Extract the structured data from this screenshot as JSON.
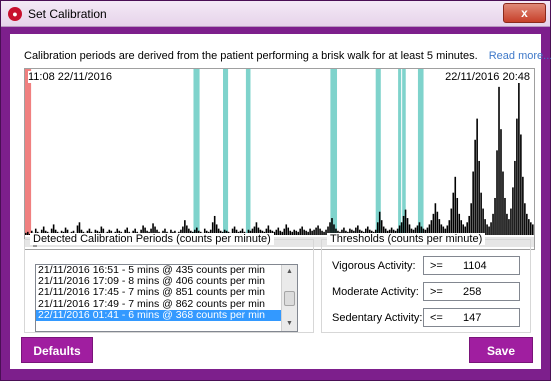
{
  "window": {
    "title": "Set Calibration",
    "close_glyph": "x",
    "app_icon": "app-logo-icon"
  },
  "info": {
    "text": "Calibration periods are derived from the patient performing a brisk walk for at least 5 minutes.",
    "link": "Read more..."
  },
  "chart": {
    "start_label": "11:08 22/11/2016",
    "end_label": "22/11/2016 20:48"
  },
  "chart_data": {
    "type": "bar",
    "title": "",
    "xlabel": "",
    "ylabel": "",
    "x_range": [
      "11:08 22/11/2016",
      "22/11/2016 20:48"
    ],
    "series": [
      {
        "values": [
          2,
          3,
          1,
          4,
          2,
          6,
          3,
          2,
          5,
          8,
          4,
          3,
          2,
          6,
          10,
          5,
          3,
          2,
          4,
          3,
          7,
          5,
          2,
          3,
          4,
          2,
          9,
          12,
          5,
          3,
          2,
          4,
          6,
          3,
          2,
          5,
          4,
          3,
          8,
          6,
          2,
          3,
          5,
          4,
          2,
          3,
          6,
          4,
          3,
          2,
          5,
          7,
          3,
          2,
          4,
          6,
          3,
          2,
          5,
          9,
          7,
          4,
          3,
          6,
          11,
          8,
          5,
          3,
          2,
          4,
          6,
          3,
          2,
          5,
          3,
          4,
          2,
          3,
          5,
          8,
          14,
          9,
          6,
          4,
          3,
          5,
          7,
          4,
          3,
          2,
          6,
          4,
          3,
          5,
          12,
          18,
          10,
          6,
          4,
          3,
          5,
          4,
          3,
          2,
          6,
          8,
          5,
          3,
          4,
          6,
          3,
          2,
          5,
          4,
          6,
          8,
          12,
          7,
          5,
          4,
          3,
          6,
          9,
          5,
          4,
          3,
          5,
          7,
          4,
          3,
          6,
          10,
          7,
          4,
          3,
          5,
          4,
          3,
          6,
          8,
          5,
          4,
          3,
          6,
          4,
          5,
          7,
          9,
          6,
          4,
          3,
          5,
          8,
          12,
          16,
          10,
          6,
          4,
          3,
          5,
          7,
          4,
          3,
          6,
          5,
          4,
          7,
          9,
          5,
          4,
          3,
          6,
          8,
          5,
          4,
          3,
          5,
          12,
          22,
          14,
          8,
          6,
          4,
          5,
          7,
          5,
          4,
          6,
          9,
          12,
          18,
          24,
          16,
          10,
          6,
          5,
          7,
          9,
          12,
          8,
          6,
          5,
          7,
          10,
          14,
          20,
          30,
          22,
          15,
          10,
          8,
          6,
          9,
          14,
          25,
          40,
          55,
          35,
          20,
          14,
          10,
          8,
          12,
          18,
          30,
          60,
          90,
          110,
          70,
          40,
          25,
          15,
          10,
          8,
          12,
          20,
          35,
          80,
          140,
          100,
          60,
          35,
          20,
          15,
          25,
          45,
          70,
          110,
          150,
          95,
          55,
          30,
          20,
          15,
          12,
          10
        ],
        "color": "#000000"
      }
    ],
    "ylim": [
      0,
      155
    ],
    "highlights": [
      {
        "kind": "flagged",
        "color": "#f08080",
        "start": 0.0,
        "end": 0.012
      },
      {
        "kind": "calibration",
        "color": "#7fd3cc",
        "start": 0.331,
        "end": 0.343
      },
      {
        "kind": "calibration",
        "color": "#7fd3cc",
        "start": 0.389,
        "end": 0.399
      },
      {
        "kind": "calibration",
        "color": "#7fd3cc",
        "start": 0.434,
        "end": 0.443
      },
      {
        "kind": "calibration",
        "color": "#7fd3cc",
        "start": 0.6,
        "end": 0.613
      },
      {
        "kind": "calibration",
        "color": "#7fd3cc",
        "start": 0.689,
        "end": 0.699
      },
      {
        "kind": "calibration",
        "color": "#7fd3cc",
        "start": 0.733,
        "end": 0.739
      },
      {
        "kind": "calibration",
        "color": "#7fd3cc",
        "start": 0.741,
        "end": 0.748
      },
      {
        "kind": "calibration",
        "color": "#7fd3cc",
        "start": 0.772,
        "end": 0.783
      }
    ]
  },
  "detected": {
    "heading": "Detected Calibration Periods (counts per minute)",
    "items": [
      "21/11/2016 16:51 - 5 mins @ 435 counts per min",
      "21/11/2016 17:09 - 8 mins @ 406 counts per min",
      "21/11/2016 17:45 - 7 mins @ 851 counts per min",
      "21/11/2016 17:49 - 7 mins @ 862 counts per min",
      "22/11/2016 01:41 - 6 mins @ 368 counts per min"
    ],
    "selected_index": 4
  },
  "thresholds": {
    "heading": "Thresholds (counts per minute)",
    "vigorous": {
      "label": "Vigorous Activity:",
      "op": ">=",
      "value": "1104"
    },
    "moderate": {
      "label": "Moderate Activity:",
      "op": ">=",
      "value": "258"
    },
    "sedentary": {
      "label": "Sedentary Activity:",
      "op": "<=",
      "value": "147"
    }
  },
  "buttons": {
    "defaults": "Defaults",
    "save": "Save"
  },
  "colors": {
    "frame": "#7d1f8c",
    "button": "#a01ea0",
    "calibration_band": "#7fd3cc",
    "flag_band": "#f08080",
    "selection": "#3399ff"
  }
}
